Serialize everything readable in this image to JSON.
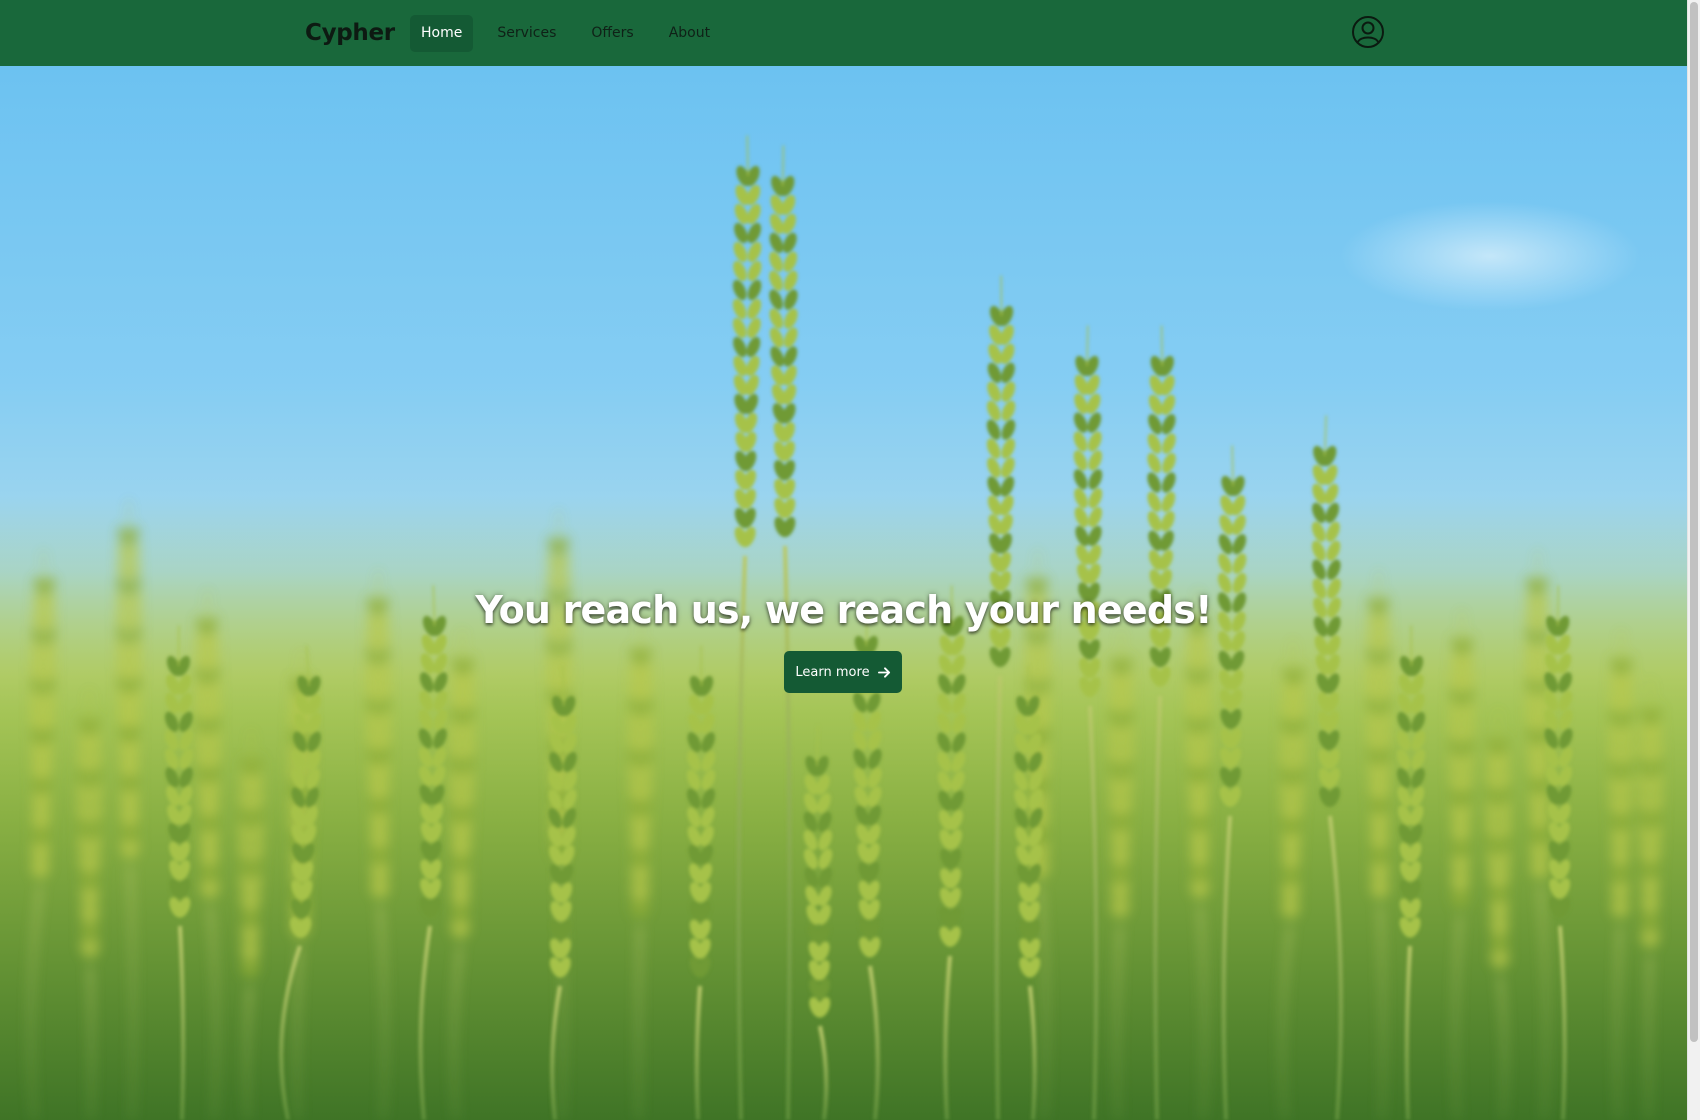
{
  "brand": {
    "name": "Cypher"
  },
  "nav": {
    "items": [
      {
        "label": "Home",
        "active": true
      },
      {
        "label": "Services",
        "active": false
      },
      {
        "label": "Offers",
        "active": false
      },
      {
        "label": "About",
        "active": false
      }
    ],
    "user_icon": "user-circle-icon"
  },
  "hero": {
    "headline": "You reach us, we reach your needs!",
    "cta_label": "Learn more",
    "cta_icon": "arrow-right-icon",
    "background": "wheat-field-photo"
  },
  "colors": {
    "navbar": "#19683b",
    "active_nav": "#145a34",
    "cta": "#145a34",
    "sky": "#7fcaf2"
  }
}
